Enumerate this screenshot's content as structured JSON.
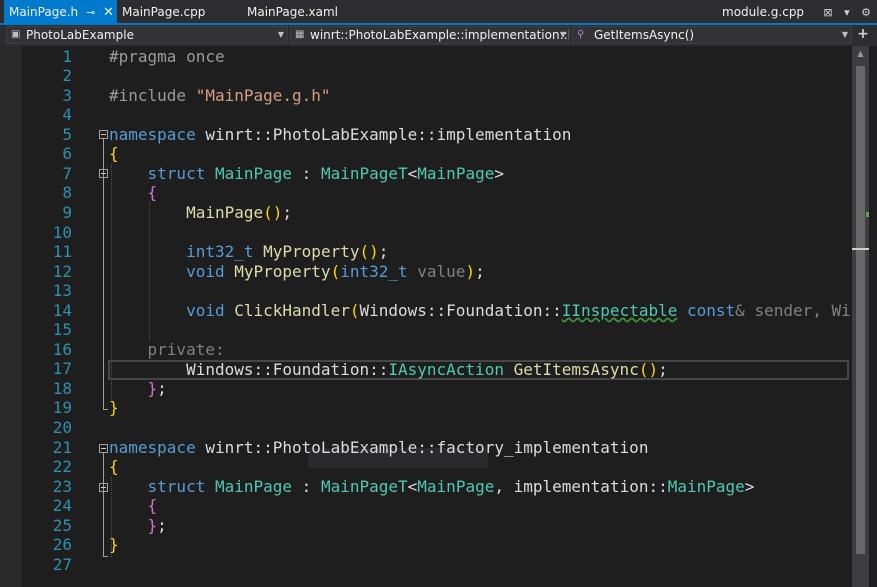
{
  "tabs": {
    "active": {
      "label": "MainPage.h",
      "pin_icon": "pin-icon",
      "close_icon": "close-icon"
    },
    "items": [
      "MainPage.cpp",
      "MainPage.xaml"
    ],
    "right_tab": "module.g.cpp",
    "right_icons": [
      "preview-icon",
      "dropdown-icon",
      "settings-icon"
    ]
  },
  "navbar": {
    "project": "PhotoLabExample",
    "scope": "winrt::PhotoLabExample::implementation::Ma",
    "member": "GetItemsAsync()",
    "split_label": "+"
  },
  "editor": {
    "line_numbers": [
      "1",
      "2",
      "3",
      "4",
      "5",
      "6",
      "7",
      "8",
      "9",
      "10",
      "11",
      "12",
      "13",
      "14",
      "15",
      "16",
      "17",
      "18",
      "19",
      "20",
      "21",
      "22",
      "23",
      "24",
      "25",
      "26",
      "27"
    ],
    "current_line": 17,
    "lines": {
      "l1": "#pragma once",
      "l3_a": "#include ",
      "l3_b": "\"MainPage.g.h\"",
      "l5_kw": "namespace",
      "l5_rest": " winrt::PhotoLabExample::implementation",
      "l6": "{",
      "l7_kw": "struct",
      "l7_name": "MainPage",
      "l7_colon": " : ",
      "l7_base": "MainPageT",
      "l7_lt": "<",
      "l7_arg": "MainPage",
      "l7_gt": ">",
      "l8": "{",
      "l9_fn": "MainPage",
      "l9_p": "()",
      "l9_semi": ";",
      "l11_kw": "int32_t",
      "l11_fn": "MyProperty",
      "l11_p": "()",
      "l11_semi": ";",
      "l12_kw": "void",
      "l12_fn": "MyProperty",
      "l12_open": "(",
      "l12_kw2": "int32_t",
      "l12_param": " value",
      "l12_close": ")",
      "l12_semi": ";",
      "l14_kw": "void",
      "l14_fn": "ClickHandler",
      "l14_open": "(",
      "l14_ns": "Windows::Foundation::",
      "l14_ty": "IInspectable",
      "l14_const": "const",
      "l14_rest": "& sender, Wind",
      "l16": "private:",
      "l17_ns": "Windows::Foundation::",
      "l17_ty": "IAsyncAction",
      "l17_fn": "GetItemsAsync",
      "l17_p": "()",
      "l17_semi": ";",
      "l18_b": "}",
      "l18_semi": ";",
      "l19": "}",
      "l21_kw": "namespace",
      "l21_rest": " winrt::PhotoLabExample::factory_implementation",
      "l22": "{",
      "l23_kw": "struct",
      "l23_name": "MainPage",
      "l23_colon": " : ",
      "l23_base": "MainPageT",
      "l23_lt": "<",
      "l23_arg": "MainPage",
      "l23_comma": ", implementation::",
      "l23_arg2": "MainPage",
      "l23_gt": ">",
      "l24": "{",
      "l25_b": "}",
      "l25_semi": ";",
      "l26": "}"
    }
  },
  "colors": {
    "accent": "#007acc",
    "keyword": "#569cd6",
    "type": "#4ec9b0",
    "string": "#d69d85",
    "line_number": "#2b91af"
  }
}
